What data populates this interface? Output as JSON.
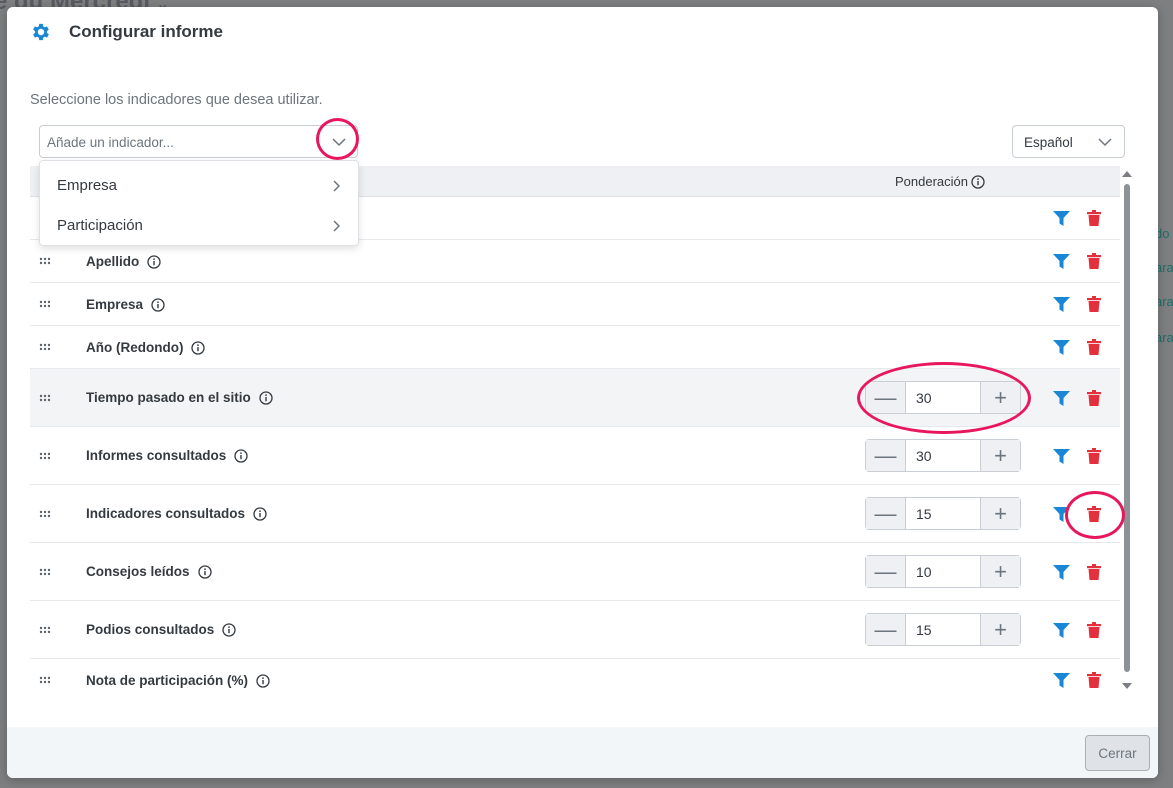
{
  "background": {
    "title": "e du Mercredi",
    "side_fragments": [
      "do",
      "ara",
      "ara",
      "ara"
    ]
  },
  "modal": {
    "title": "Configurar informe",
    "instruction": "Seleccione los indicadores que desea utilizar.",
    "indicator_select": {
      "placeholder": "Añade un indicador..."
    },
    "language_select": {
      "value": "Español"
    },
    "dropdown": {
      "items": [
        {
          "label": "Empresa"
        },
        {
          "label": "Participación"
        }
      ]
    },
    "table": {
      "weight_header": "Ponderación",
      "rows": [
        {
          "label": "",
          "weight": null
        },
        {
          "label": "Apellido",
          "weight": null
        },
        {
          "label": "Empresa",
          "weight": null
        },
        {
          "label": "Año (Redondo)",
          "weight": null
        },
        {
          "label": "Tiempo pasado en el sitio",
          "weight": "30"
        },
        {
          "label": "Informes consultados",
          "weight": "30"
        },
        {
          "label": "Indicadores consultados",
          "weight": "15"
        },
        {
          "label": "Consejos leídos",
          "weight": "10"
        },
        {
          "label": "Podios consultados",
          "weight": "15"
        },
        {
          "label": "Nota de participación (%)",
          "weight": null
        }
      ]
    },
    "footer": {
      "close_label": "Cerrar"
    }
  },
  "colors": {
    "accent_blue": "#1a86d6",
    "delete_red": "#e42f3d",
    "annotation_pink": "#e8175d"
  }
}
